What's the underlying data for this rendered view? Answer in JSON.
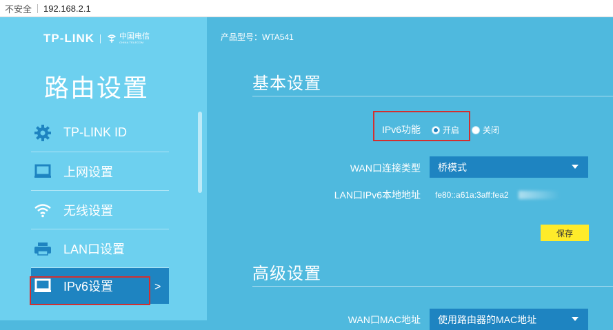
{
  "browser": {
    "security_label": "不安全",
    "url": "192.168.2.1"
  },
  "header": {
    "brand": "TP-LINK",
    "partner_logo_text": "中国电信",
    "partner_logo_small": "CHINA TELECOM",
    "model_label": "产品型号：WTA541"
  },
  "sidebar": {
    "title": "路由设置",
    "items": [
      {
        "label": "TP-LINK ID",
        "icon": "gear-icon"
      },
      {
        "label": "上网设置",
        "icon": "monitor-icon"
      },
      {
        "label": "无线设置",
        "icon": "wifi-icon"
      },
      {
        "label": "LAN口设置",
        "icon": "printer-icon"
      },
      {
        "label": "IPv6设置",
        "icon": "monitor-icon",
        "active": true
      }
    ],
    "arrow": ">"
  },
  "basic": {
    "title": "基本设置",
    "ipv6_label": "IPv6功能",
    "on_label": "开启",
    "off_label": "关闭",
    "ipv6_state": "on",
    "wan_type_label": "WAN口连接类型",
    "wan_type_value": "桥模式",
    "lan_addr_label": "LAN口IPv6本地地址",
    "lan_addr_value": "fe80::a61a:3aff:fea2",
    "save_label": "保存"
  },
  "advanced": {
    "title": "高级设置",
    "mac_label": "WAN口MAC地址",
    "mac_value": "使用路由器的MAC地址"
  },
  "colors": {
    "sidebar_bg": "#6dd0ef",
    "main_bg": "#4fb9de",
    "accent": "#1e84c1",
    "save_button": "#ffeb2a",
    "highlight_box": "#d32f2f"
  }
}
